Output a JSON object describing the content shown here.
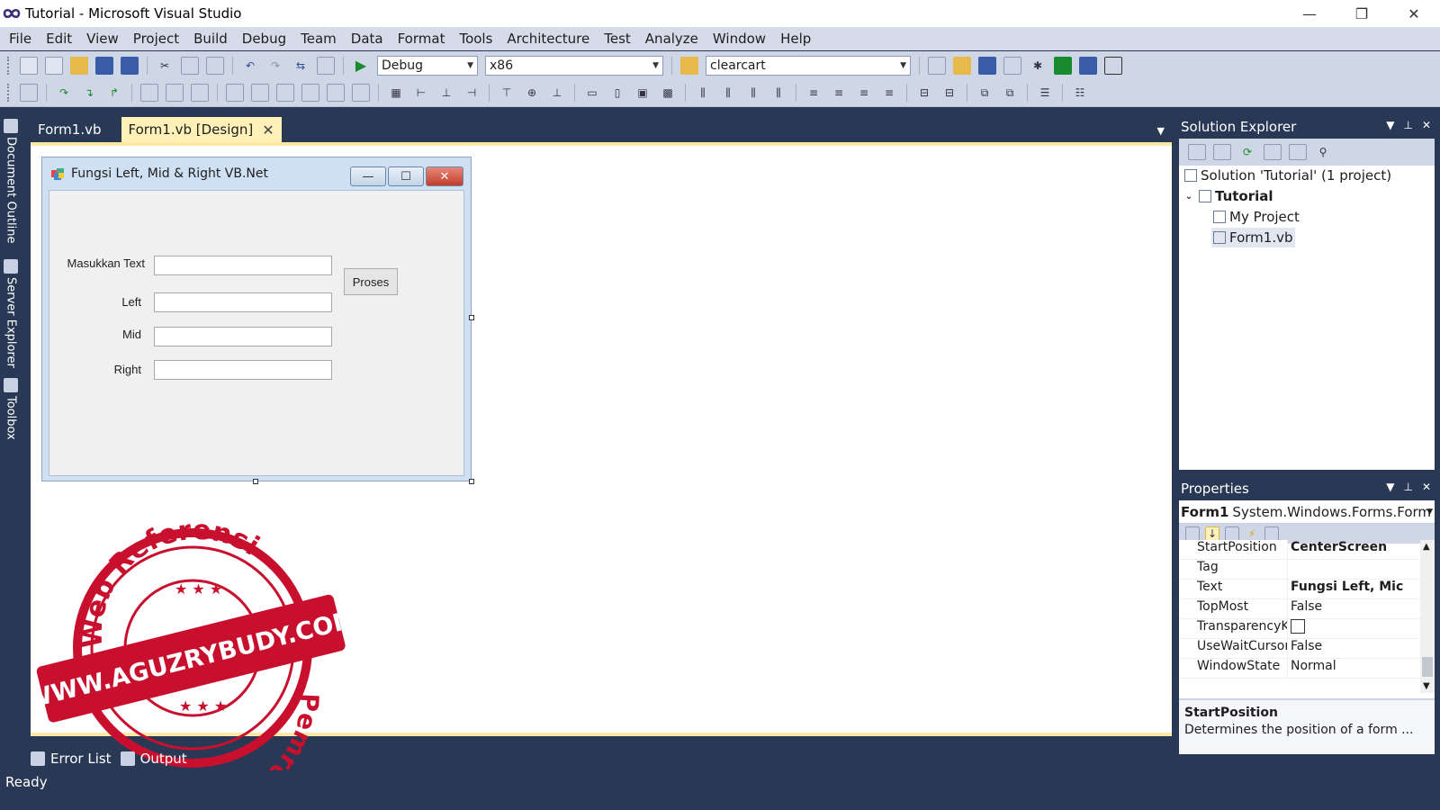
{
  "window": {
    "title": "Tutorial - Microsoft Visual Studio",
    "minimize": "—",
    "restore": "❐",
    "close": "✕"
  },
  "menu": [
    "File",
    "Edit",
    "View",
    "Project",
    "Build",
    "Debug",
    "Team",
    "Data",
    "Format",
    "Tools",
    "Architecture",
    "Test",
    "Analyze",
    "Window",
    "Help"
  ],
  "toolbar": {
    "config": "Debug",
    "platform": "x86",
    "find": "clearcart"
  },
  "left_strip": [
    "Document Outline",
    "Server Explorer",
    "Toolbox"
  ],
  "doc_tabs": [
    {
      "label": "Form1.vb"
    },
    {
      "label": "Form1.vb [Design]",
      "close": "✕"
    }
  ],
  "form": {
    "title": "Fungsi Left, Mid & Right VB.Net",
    "labels": {
      "masukkan": "Masukkan Text",
      "left": "Left",
      "mid": "Mid",
      "right": "Right"
    },
    "button": "Proses"
  },
  "watermark": {
    "top_text": "Web Referensi",
    "banner": "WWW.AGUZRYBUDY.COM",
    "bottom_text": "Pemrograman"
  },
  "solution_explorer": {
    "title": "Solution Explorer",
    "nodes": [
      "Solution 'Tutorial' (1 project)",
      "Tutorial",
      "My Project",
      "Form1.vb"
    ]
  },
  "properties": {
    "title": "Properties",
    "object_name": "Form1",
    "object_type": "System.Windows.Forms.Form",
    "rows": [
      {
        "name": "StartPosition",
        "value": "CenterScreen"
      },
      {
        "name": "Tag",
        "value": ""
      },
      {
        "name": "Text",
        "value": "Fungsi Left, Mic"
      },
      {
        "name": "TopMost",
        "value": "False"
      },
      {
        "name": "TransparencyKey",
        "value": ""
      },
      {
        "name": "UseWaitCursor",
        "value": "False"
      },
      {
        "name": "WindowState",
        "value": "Normal"
      }
    ],
    "desc_title": "StartPosition",
    "desc_text": "Determines the position of a form ..."
  },
  "bottom_tabs": [
    "Error List",
    "Output"
  ],
  "status": "Ready",
  "colors": {
    "chrome": "#293955",
    "menu": "#d6dbe9",
    "active_tab": "#fff1b8",
    "stamp": "#c8102e"
  }
}
